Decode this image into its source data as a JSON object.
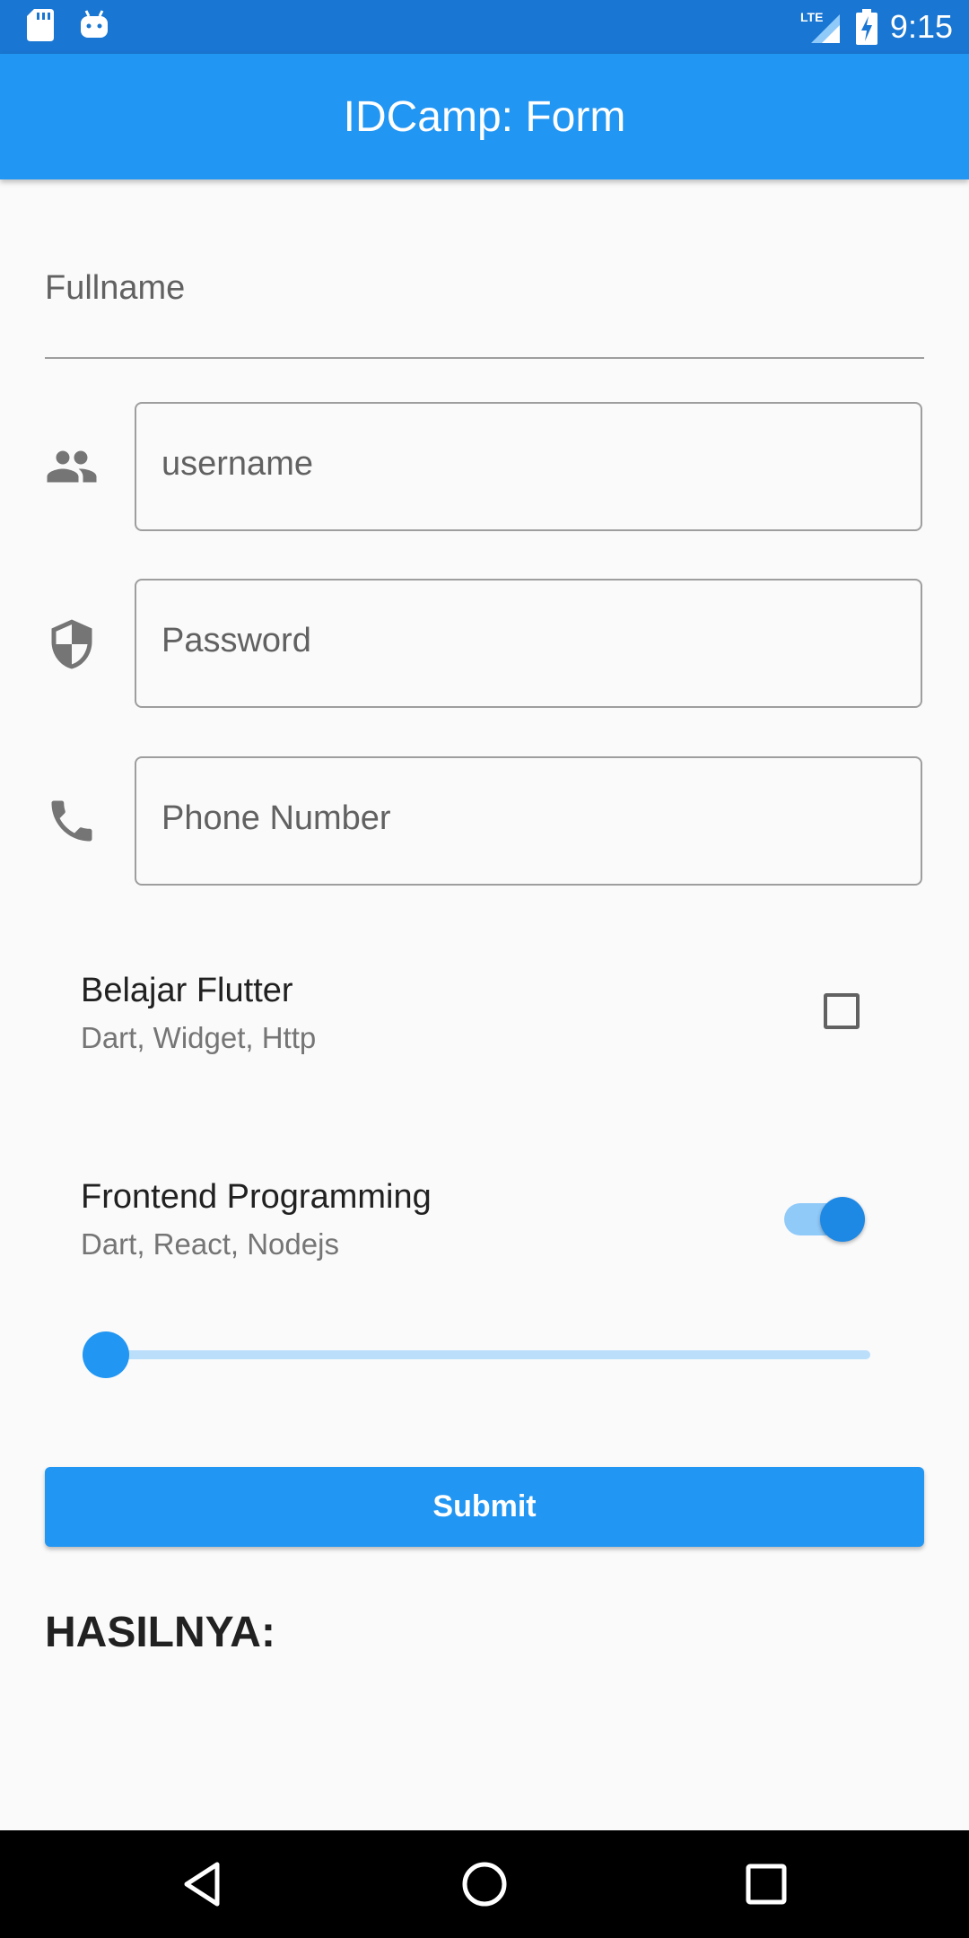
{
  "status_bar": {
    "time": "9:15",
    "network": "LTE",
    "icons": [
      "sd-card-icon",
      "android-icon",
      "lte-signal-icon",
      "battery-charging-icon"
    ]
  },
  "app_bar": {
    "title": "IDCamp: Form"
  },
  "form": {
    "fullname": {
      "label": "Fullname",
      "value": ""
    },
    "username": {
      "placeholder": "username",
      "icon": "people-icon",
      "value": ""
    },
    "password": {
      "placeholder": "Password",
      "icon": "shield-icon",
      "value": ""
    },
    "phone": {
      "placeholder": "Phone Number",
      "icon": "phone-icon",
      "value": ""
    },
    "checkbox_tile": {
      "title": "Belajar Flutter",
      "subtitle": "Dart, Widget, Http",
      "checked": false
    },
    "switch_tile": {
      "title": "Frontend Programming",
      "subtitle": "Dart, React, Nodejs",
      "on": true
    },
    "slider": {
      "value": 0,
      "min": 0,
      "max": 100
    },
    "submit_label": "Submit"
  },
  "result_label": "HASILNYA:",
  "colors": {
    "primary": "#2196f3",
    "primary_dark": "#1976d2",
    "background": "#fafafa"
  },
  "nav_bar": {
    "icons": [
      "back-icon",
      "home-icon",
      "recents-icon"
    ]
  }
}
